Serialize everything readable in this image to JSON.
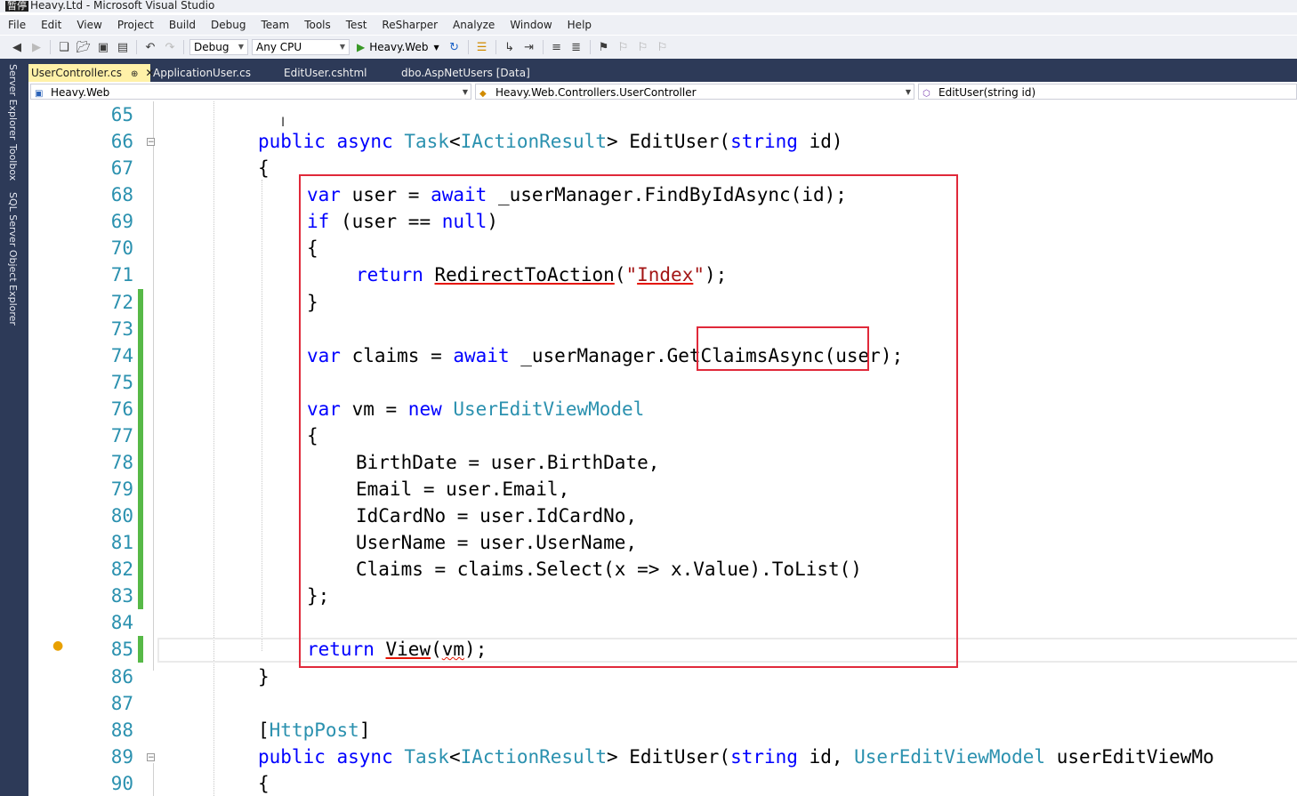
{
  "window": {
    "badge": "暂停",
    "title": "Heavy.Ltd - Microsoft Visual Studio"
  },
  "menu": [
    "File",
    "Edit",
    "View",
    "Project",
    "Build",
    "Debug",
    "Team",
    "Tools",
    "Test",
    "ReSharper",
    "Analyze",
    "Window",
    "Help"
  ],
  "toolbar": {
    "config": "Debug",
    "platform": "Any CPU",
    "run_target": "Heavy.Web"
  },
  "side_tabs": [
    "Server Explorer",
    "Toolbox",
    "SQL Server Object Explorer"
  ],
  "doc_tabs": [
    {
      "label": "UserController.cs",
      "active": true
    },
    {
      "label": "ApplicationUser.cs",
      "active": false
    },
    {
      "label": "EditUser.cshtml",
      "active": false
    },
    {
      "label": "dbo.AspNetUsers [Data]",
      "active": false
    }
  ],
  "navbar": {
    "project": "Heavy.Web",
    "class": "Heavy.Web.Controllers.UserController",
    "member": "EditUser(string id)"
  },
  "editor": {
    "line_numbers": [
      "65",
      "66",
      "67",
      "68",
      "69",
      "70",
      "71",
      "72",
      "73",
      "74",
      "75",
      "76",
      "77",
      "78",
      "79",
      "80",
      "81",
      "82",
      "83",
      "84",
      "85",
      "86",
      "87",
      "88",
      "89",
      "90"
    ],
    "changed_lines": [
      "72",
      "73",
      "74",
      "75",
      "76",
      "77",
      "78",
      "79",
      "80",
      "81",
      "82",
      "83",
      "85"
    ],
    "folded_lines": [
      "66",
      "89"
    ],
    "code": {
      "l66_mod": "public async ",
      "l66_task": "Task",
      "l66_lt": "<",
      "l66_iar": "IActionResult",
      "l66_rest": "> EditUser(",
      "l66_string": "string",
      "l66_end": " id)",
      "l67": "{",
      "l68_var": "var",
      "l68_a": " user = ",
      "l68_await": "await",
      "l68_b": " _userManager.FindByIdAsync(id);",
      "l69_if": "if",
      "l69_a": " (user == ",
      "l69_null": "null",
      "l69_b": ")",
      "l70": "{",
      "l71_ret": "return",
      "l71_sp": " ",
      "l71_fn": "RedirectToAction",
      "l71_p": "(",
      "l71_q1": "\"",
      "l71_idx": "Index",
      "l71_q2": "\"",
      "l71_end": ");",
      "l72": "}",
      "l74_var": "var",
      "l74_a": " claims = ",
      "l74_await": "await",
      "l74_b": " _userManager.GetClaimsAsync(user);",
      "l76_var": "var",
      "l76_a": " vm = ",
      "l76_new": "new",
      "l76_sp": " ",
      "l76_type": "UserEditViewModel",
      "l77": "{",
      "l78": "BirthDate = user.BirthDate,",
      "l79": "Email = user.Email,",
      "l80": "IdCardNo = user.IdCardNo,",
      "l81": "UserName = user.UserName,",
      "l82": "Claims = claims.Select(x => x.Value).ToList()",
      "l83": "};",
      "l85_ret": "return",
      "l85_sp": " ",
      "l85_view": "View",
      "l85_p": "(",
      "l85_vm": "vm",
      "l85_end": ");",
      "l86": "}",
      "l88_a": "[",
      "l88_attr": "HttpPost",
      "l88_b": "]",
      "l89_mod": "public async ",
      "l89_task": "Task",
      "l89_lt": "<",
      "l89_iar": "IActionResult",
      "l89_rest": "> EditUser(",
      "l89_string": "string",
      "l89_mid": " id, ",
      "l89_type": "UserEditViewModel",
      "l89_end": " userEditViewMo",
      "l90": "{"
    }
  },
  "colors": {
    "keyword": "#0000ff",
    "type": "#2b91af",
    "string": "#a31515",
    "annotation_box": "#e0293a",
    "change_bar": "#57b947"
  }
}
